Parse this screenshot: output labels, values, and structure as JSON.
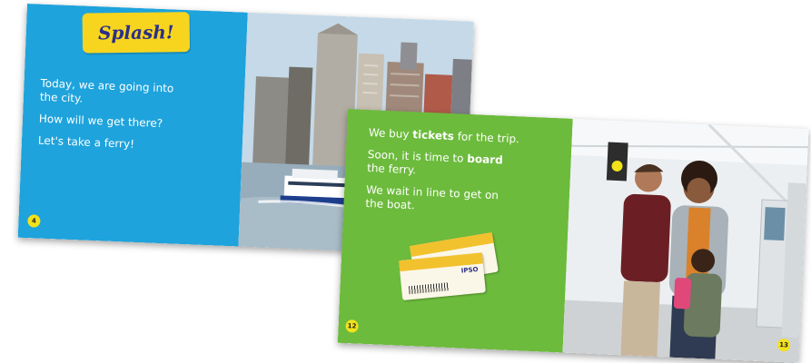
{
  "spread_left": {
    "banner": "Splash!",
    "lines": [
      "Today, we are going into",
      "the city.",
      "How will we get there?",
      "Let's take a ferry!"
    ],
    "page_number": "4",
    "photo_icon": "city-skyline-with-ferry"
  },
  "spread_right": {
    "line1_before": "We buy ",
    "line1_bold": "tickets",
    "line1_after": " for the trip.",
    "line2_before": "Soon, it is time to ",
    "line2_bold": "board",
    "line3": "the ferry.",
    "line4": "We wait in line to get on",
    "line5": "the boat.",
    "left_page_number": "12",
    "right_page_number": "13",
    "ticket_logo": "IPSO",
    "photo_icon": "family-at-ticket-kiosk"
  },
  "colors": {
    "blue_page": "#1ea3dc",
    "green_page": "#6cbb3c",
    "banner_yellow": "#f7d51e",
    "banner_text": "#2b2f88",
    "page_number_yellow": "#f2e21a"
  }
}
